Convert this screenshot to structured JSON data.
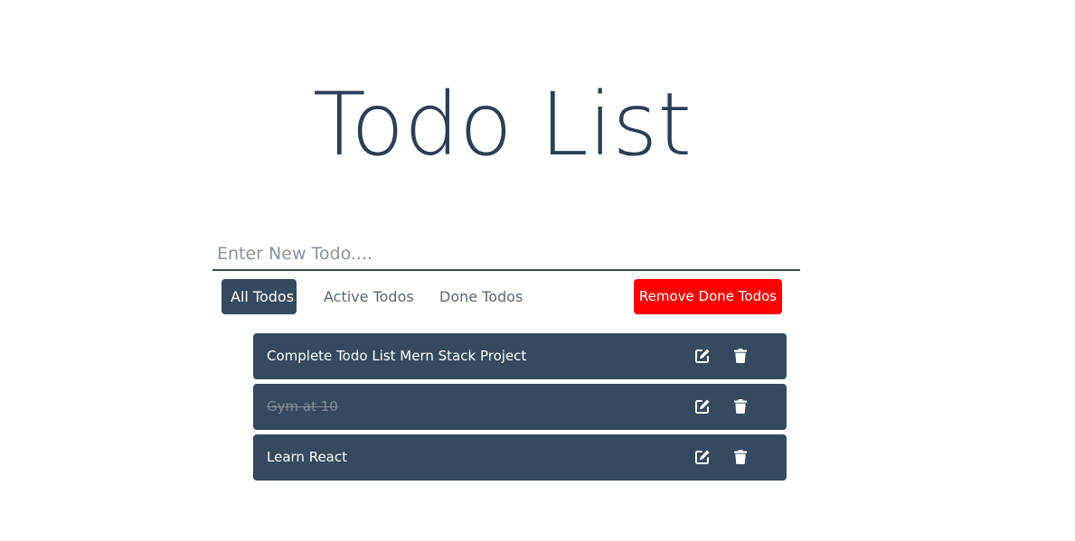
{
  "header": {
    "title": "Todo List"
  },
  "new_todo": {
    "placeholder": "Enter New Todo....",
    "value": ""
  },
  "filters": {
    "all": "All Todos",
    "active": "Active Todos",
    "done": "Done Todos",
    "selected": "All Todos"
  },
  "actions": {
    "remove_done": "Remove Done Todos"
  },
  "todos": [
    {
      "text": "Complete Todo List Mern Stack Project",
      "done": false
    },
    {
      "text": "Gym at 10",
      "done": true
    },
    {
      "text": "Learn React",
      "done": false
    }
  ],
  "icons": {
    "edit": "edit-icon",
    "delete": "trash-icon"
  },
  "colors": {
    "primary": "#344a5f",
    "title": "#2b3e54",
    "danger": "#ff0000",
    "done_text": "#7f8c99"
  }
}
